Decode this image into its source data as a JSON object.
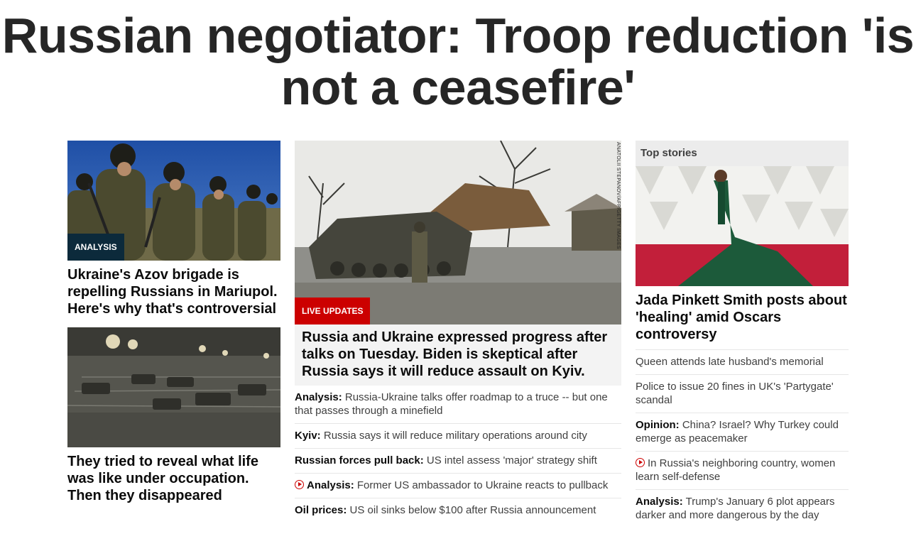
{
  "headline": "Russian negotiator: Troop reduction 'is not a ceasefire'",
  "left": {
    "story1": {
      "badge": "ANALYSIS",
      "title": "Ukraine's Azov brigade is repelling Russians in Mariupol. Here's why that's controversial"
    },
    "story2": {
      "title": "They tried to reveal what life was like under occupation. Then they disappeared"
    }
  },
  "middle": {
    "badge": "LIVE UPDATES",
    "photo_credit": "ANATOLII STEPANOV/AFP/GETTY IMAGES",
    "title": "Russia and Ukraine expressed progress after talks on Tuesday. Biden is skeptical after Russia says it will reduce assault on Kyiv.",
    "links": [
      {
        "label": "Analysis:",
        "text": "Russia-Ukraine talks offer roadmap to a truce -- but one that passes through a minefield",
        "video": false
      },
      {
        "label": "Kyiv:",
        "text": "Russia says it will reduce military operations around city",
        "video": false
      },
      {
        "label": "Russian forces pull back:",
        "text": "US intel assess 'major' strategy shift",
        "video": false
      },
      {
        "label": "Analysis:",
        "text": "Former US ambassador to Ukraine reacts to pullback",
        "video": true
      },
      {
        "label": "Oil prices:",
        "text": "US oil sinks below $100 after Russia announcement",
        "video": false
      }
    ]
  },
  "right": {
    "section_title": "Top stories",
    "title": "Jada Pinkett Smith posts about 'healing' amid Oscars controversy",
    "links": [
      {
        "label": "",
        "text": "Queen attends late husband's memorial",
        "video": false
      },
      {
        "label": "",
        "text": "Police to issue 20 fines in UK's 'Partygate' scandal",
        "video": false
      },
      {
        "label": "Opinion:",
        "text": "China? Israel? Why Turkey could emerge as peacemaker",
        "video": false
      },
      {
        "label": "",
        "text": "In Russia's neighboring country, women learn self-defense",
        "video": true
      },
      {
        "label": "Analysis:",
        "text": "Trump's January 6 plot appears darker and more dangerous by the day",
        "video": false
      }
    ]
  },
  "icons": {
    "video": "play-circle-icon"
  },
  "colors": {
    "live_red": "#cc0000",
    "analysis_navy": "#0c2a3b",
    "headline": "#262626"
  }
}
